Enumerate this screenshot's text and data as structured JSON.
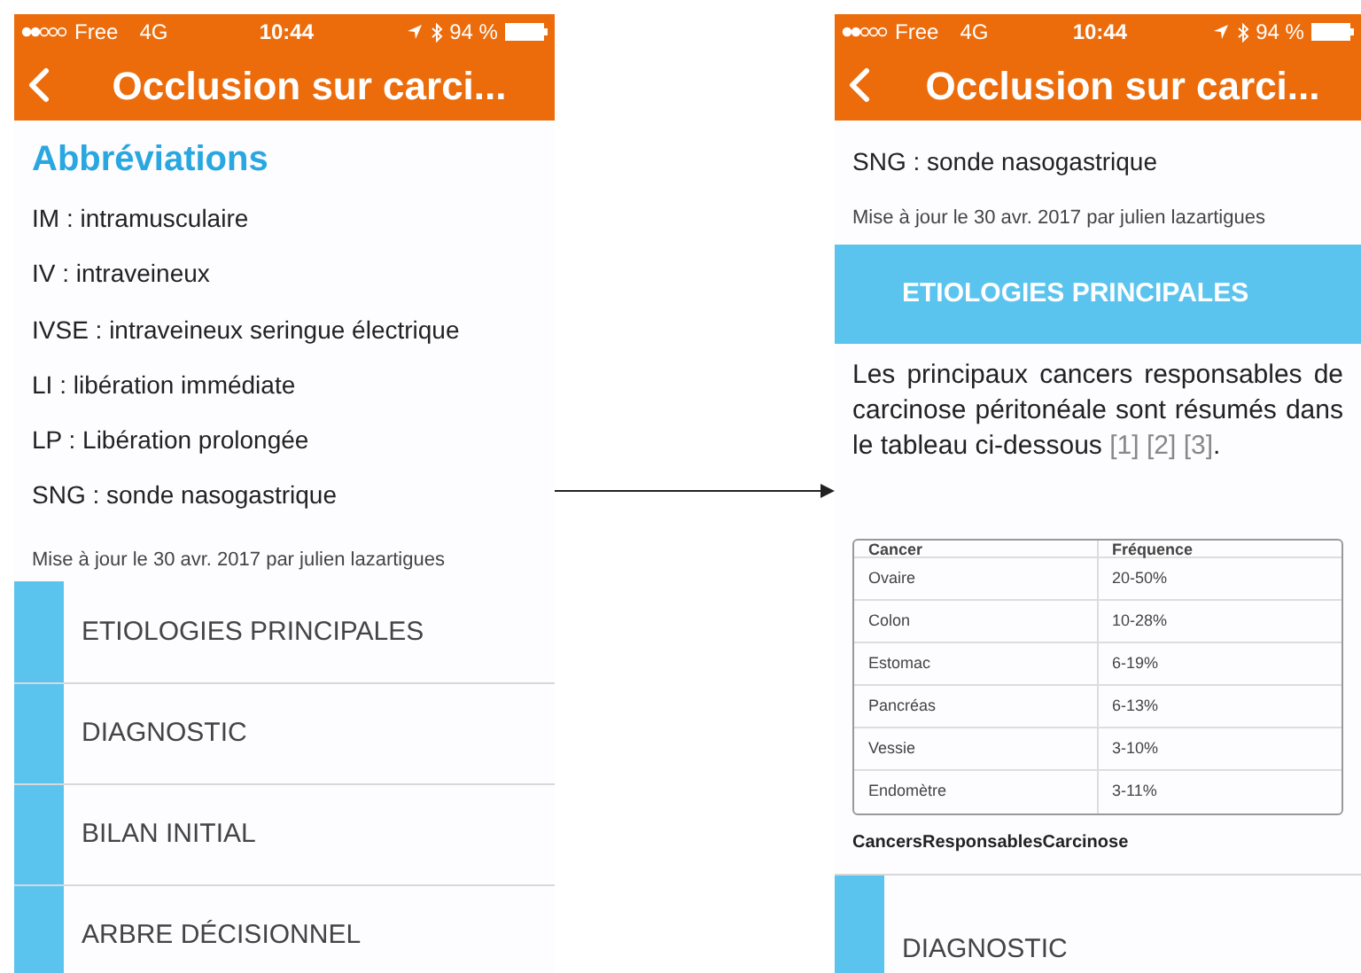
{
  "screens": [
    {
      "status_bar": {
        "carrier": "Free",
        "network": "4G",
        "time": "10:44",
        "battery": "94 %"
      },
      "nav": {
        "title": "Occlusion sur carci..."
      },
      "heading": "Abbréviations",
      "abbreviations": [
        "IM : intramusculaire",
        "IV : intraveineux",
        "IVSE : intraveineux seringue électrique",
        "LI : libération immédiate",
        "LP : Libération prolongée",
        "SNG : sonde nasogastrique"
      ],
      "updated": "Mise à jour le 30 avr. 2017 par julien lazartigues",
      "sections": [
        {
          "label": "ETIOLOGIES PRINCIPALES",
          "expanded": false
        },
        {
          "label": "DIAGNOSTIC",
          "expanded": false
        },
        {
          "label": "BILAN INITIAL",
          "expanded": false
        },
        {
          "label": "ARBRE DÉCISIONNEL",
          "expanded": false
        }
      ]
    },
    {
      "status_bar": {
        "carrier": "Free",
        "network": "4G",
        "time": "10:44",
        "battery": "94 %"
      },
      "nav": {
        "title": "Occlusion sur carci..."
      },
      "abbreviations": [
        "SNG : sonde nasogastrique"
      ],
      "updated": "Mise à jour le 30 avr. 2017 par julien lazartigues",
      "sections": [
        {
          "label": "ETIOLOGIES PRINCIPALES",
          "expanded": true,
          "paragraph": "Les principaux cancers responsables de carcinose péritonéale sont résumés dans le tableau ci-dessous",
          "refs": [
            "[1]",
            "[2]",
            "[3]"
          ],
          "paragraph_end": ".",
          "table": {
            "columns": [
              "Cancer",
              "Fréquence"
            ],
            "rows": [
              [
                "Ovaire",
                "20-50%"
              ],
              [
                "Colon",
                "10-28%"
              ],
              [
                "Estomac",
                "6-19%"
              ],
              [
                "Pancréas",
                "6-13%"
              ],
              [
                "Vessie",
                "3-10%"
              ],
              [
                "Endomètre",
                "3-11%"
              ]
            ]
          },
          "caption": "CancersResponsablesCarcinose"
        },
        {
          "label": "DIAGNOSTIC",
          "expanded": false
        }
      ]
    }
  ]
}
